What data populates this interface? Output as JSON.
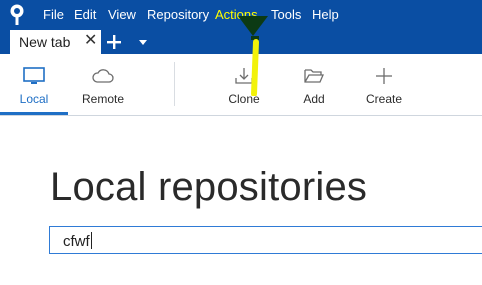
{
  "menubar": {
    "items": [
      "File",
      "Edit",
      "View",
      "Repository",
      "Actions",
      "Tools",
      "Help"
    ]
  },
  "tabs": {
    "active_label": "New tab"
  },
  "toolbar": {
    "local_label": "Local",
    "remote_label": "Remote",
    "clone_label": "Clone",
    "add_label": "Add",
    "create_label": "Create"
  },
  "main": {
    "title": "Local repositories",
    "search_value": "cfwf"
  },
  "colors": {
    "menubar_bg": "#0a4ea3",
    "accent": "#1f6fc5",
    "annotation": "#ffff00"
  }
}
